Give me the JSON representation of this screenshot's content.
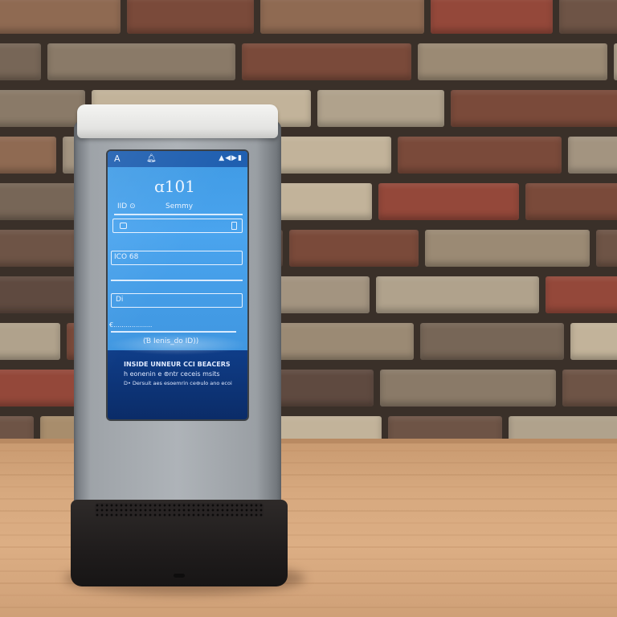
{
  "scene": {
    "background": "brick-wall",
    "surface": "wooden-table",
    "colors": {
      "screen_blue": "#4aa4ee",
      "screen_navy": "#0b2c68",
      "device_gray": "#aeb3b8",
      "device_cap": "#eeeeec",
      "base_black": "#1f1c1c"
    }
  },
  "screen": {
    "status_left": "A",
    "status_icon": "bell-icon",
    "status_right": "▲◀▶▮",
    "logo": "ɑ101",
    "row1_left": "IID ⊙",
    "row1_right": "Semmy",
    "field3_label": "ICO 68",
    "field4_label": "Di",
    "field5_label": "€...................",
    "link_text": "(Ɓ Ienis_do ID))",
    "footer_line1": "INSIDE UNNEUR CCI BEACERS",
    "footer_line2": "h eonenin e ⊚ntr ceceis msits",
    "footer_line3": "D• Dersuit aes esoemrin ce⊚ulo ano ecoi"
  }
}
